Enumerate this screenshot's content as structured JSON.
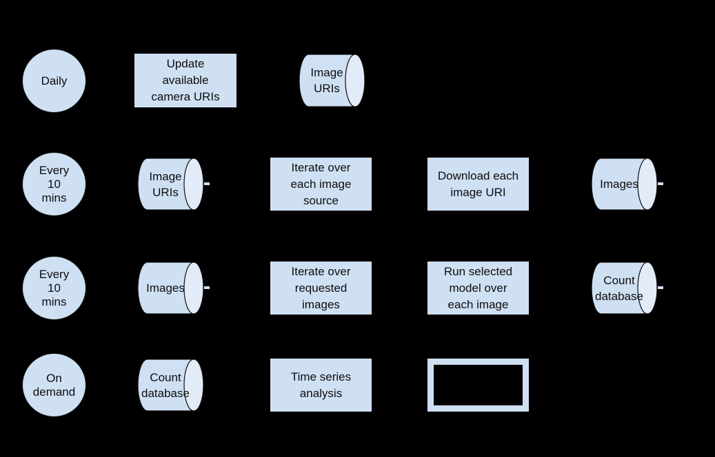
{
  "diagram": {
    "background_color": "#000000",
    "shape_fill": "#cfe0f3",
    "shape_cap_fill": "#e2ebf7",
    "stroke_color": "#0e0f0f",
    "text_color": "#0d0d0d",
    "rows": [
      {
        "id": "row-daily",
        "trigger": "Daily",
        "nodes": [
          {
            "id": "update-camera-uris",
            "type": "process",
            "label": "Update\navailable\ncamera URIs"
          },
          {
            "id": "image-uris-store-1",
            "type": "datastore",
            "label": "Image\nURIs"
          }
        ]
      },
      {
        "id": "row-download",
        "trigger": "Every\n10\nmins",
        "nodes": [
          {
            "id": "image-uris-store-2",
            "type": "datastore",
            "label": "Image\nURIs"
          },
          {
            "id": "iterate-image-sources",
            "type": "process",
            "label": "Iterate over\neach image\nsource"
          },
          {
            "id": "download-image-uri",
            "type": "process",
            "label": "Download each\nimage URI"
          },
          {
            "id": "images-store-1",
            "type": "datastore",
            "label": "Images"
          }
        ]
      },
      {
        "id": "row-inference",
        "trigger": "Every\n10\nmins",
        "nodes": [
          {
            "id": "images-store-2",
            "type": "datastore",
            "label": "Images"
          },
          {
            "id": "iterate-requested-images",
            "type": "process",
            "label": "Iterate over\nrequested\nimages"
          },
          {
            "id": "run-selected-model",
            "type": "process",
            "label": "Run selected\nmodel over\neach image"
          },
          {
            "id": "count-database-store-1",
            "type": "datastore",
            "label": "Count\ndatabase"
          }
        ]
      },
      {
        "id": "row-on-demand",
        "trigger": "On\ndemand",
        "nodes": [
          {
            "id": "count-database-store-2",
            "type": "datastore",
            "label": "Count\ndatabase"
          },
          {
            "id": "time-series-analysis",
            "type": "process",
            "label": "Time series\nanalysis"
          },
          {
            "id": "output-box",
            "type": "process-outline",
            "label": ""
          }
        ]
      }
    ]
  }
}
